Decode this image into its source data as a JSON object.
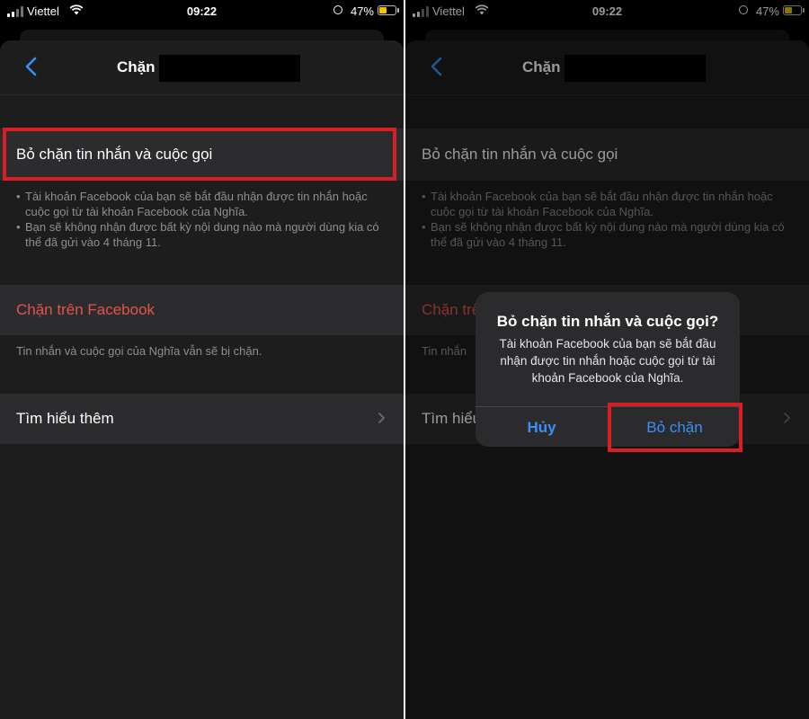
{
  "status_bar": {
    "carrier": "Viettel",
    "time": "09:22",
    "battery_percent": "47%",
    "battery_level": 0.47
  },
  "nav": {
    "title": "Chặn"
  },
  "settings": {
    "unblock_cell_label": "Bỏ chặn tin nhắn và cuộc gọi",
    "unblock_notes": [
      "Tài khoản Facebook của bạn sẽ bắt đầu nhận được tin nhắn hoặc cuộc gọi từ tài khoản Facebook của Nghĩa.",
      "Bạn sẽ không nhận được bất kỳ nội dung nào mà người dùng kia có thể đã gửi vào 4 tháng 11."
    ],
    "block_facebook_label": "Chặn trên Facebook",
    "block_facebook_note": "Tin nhắn và cuộc gọi của Nghĩa vẫn sẽ bị chặn.",
    "learn_more_label": "Tìm hiểu thêm"
  },
  "right_panel": {
    "block_facebook_partial": "Chặn trê",
    "block_facebook_note_partial": "Tin nhắn",
    "learn_more_partial": "Tìm hiểu"
  },
  "alert": {
    "title": "Bỏ chặn tin nhắn và cuộc gọi?",
    "message": "Tài khoản Facebook của bạn sẽ bắt đầu nhận được tin nhắn hoặc cuộc gọi từ tài khoản Facebook của Nghĩa.",
    "cancel_label": "Hủy",
    "confirm_label": "Bỏ chặn"
  },
  "colors": {
    "background": "#000000",
    "sheet": "#1d1d1e",
    "cell": "#2c2c2e",
    "destructive": "#e5534b",
    "accent_blue": "#3b8ff5",
    "highlight": "#d81f25"
  }
}
